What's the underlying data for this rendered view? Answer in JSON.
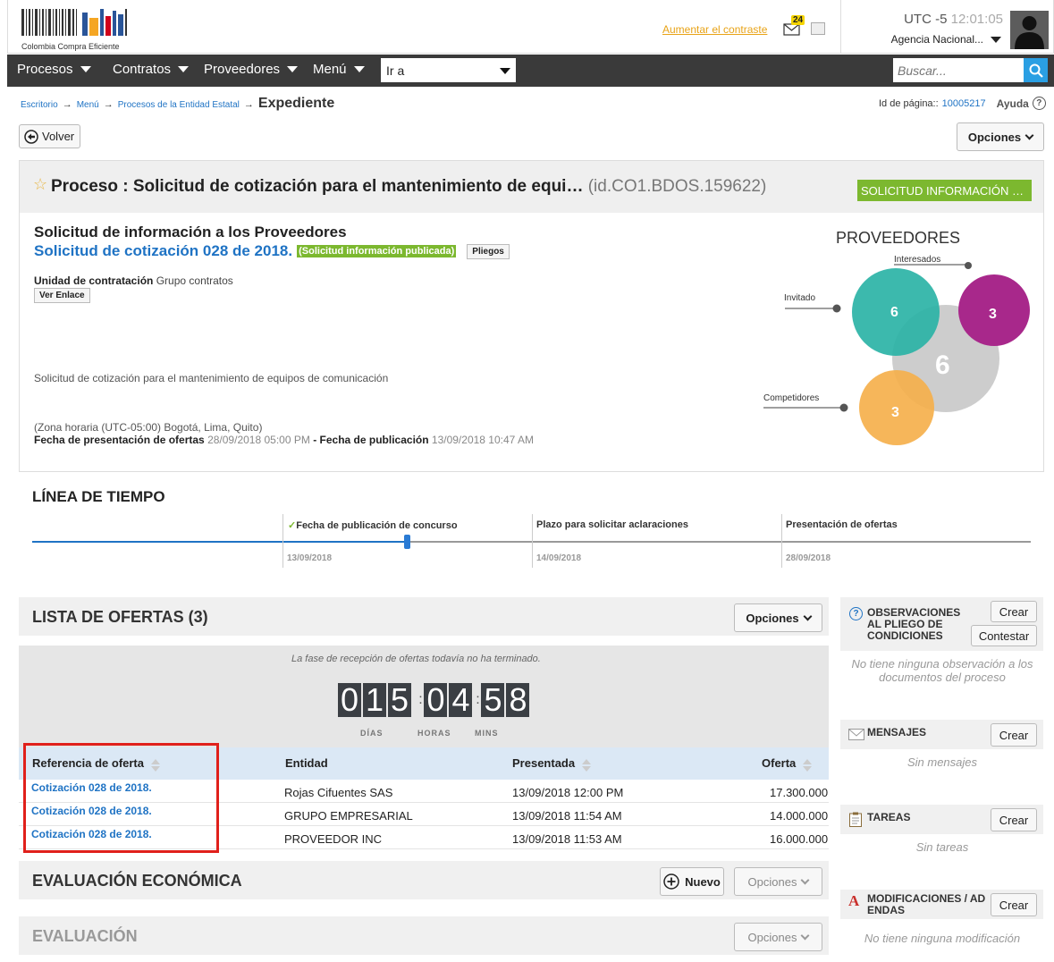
{
  "header": {
    "logo_text": "Colombia Compra Eficiente",
    "contrast_link": "Aumentar el contraste",
    "mail_count": "24",
    "timezone": "UTC -5",
    "time": "12:01:05",
    "agency": "Agencia Nacional..."
  },
  "nav": {
    "items": [
      "Procesos",
      "Contratos",
      "Proveedores",
      "Menú"
    ],
    "goto_value": "Ir a",
    "search_placeholder": "Buscar..."
  },
  "breadcrumb": {
    "items": [
      "Escritorio",
      "Menú",
      "Procesos de la Entidad Estatal"
    ],
    "current": "Expediente",
    "arrow": "→",
    "page_id_label": "Id de página::",
    "page_id": "10005217",
    "help": "Ayuda"
  },
  "toolbar": {
    "back": "Volver",
    "options": "Opciones"
  },
  "process": {
    "title": "Proceso : Solicitud de cotización para el mantenimiento de equi…",
    "id": "(id.CO1.BDOS.159622)",
    "status": "SOLICITUD INFORMACIÓN …",
    "type": "Solicitud de información a los Proveedores",
    "name": "Solicitud de cotización 028 de 2018.",
    "badge": "(Solicitud información publicada)",
    "pliegos": "Pliegos",
    "unit_label": "Unidad de contratación",
    "unit_value": "Grupo contratos",
    "link_button": "Ver Enlace",
    "description": "Solicitud de cotización para el mantenimiento de equipos de comunicación",
    "tz": "(Zona horaria (UTC-05:00) Bogotá, Lima, Quito)",
    "offers_date_label": "Fecha de presentación de ofertas",
    "offers_date": "28/09/2018 05:00 PM",
    "dash": "-",
    "pub_date_label": "Fecha de publicación",
    "pub_date": "13/09/2018 10:47 AM"
  },
  "suppliers": {
    "title": "PROVEEDORES",
    "interested_label": "Interesados",
    "invited_label": "Invitado",
    "competitors_label": "Competidores",
    "interested": "6",
    "third": "3",
    "total": "6",
    "competitors": "3",
    "colors": {
      "interested": "#2bb3a6",
      "third": "#a8288b",
      "total": "#c4c4c4",
      "competitors": "#f5b04c"
    }
  },
  "timeline": {
    "title": "LÍNEA DE TIEMPO",
    "milestones": [
      {
        "label": "Fecha de publicación de concurso",
        "date": "13/09/2018"
      },
      {
        "label": "Plazo para solicitar aclaraciones",
        "date": "14/09/2018"
      },
      {
        "label": "Presentación de ofertas",
        "date": "28/09/2018"
      }
    ]
  },
  "offers": {
    "title": "LISTA DE OFERTAS (3)",
    "options": "Opciones",
    "notice": "La fase de recepción de ofertas todavía no ha terminado.",
    "countdown": {
      "days": "015",
      "hours": "04",
      "mins": "58",
      "days_label": "DÍAS",
      "hours_label": "HORAS",
      "mins_label": "MINS"
    },
    "columns": [
      "Referencia de oferta",
      "Entidad",
      "Presentada",
      "Oferta"
    ],
    "rows": [
      {
        "ref": "Cotización 028 de 2018.",
        "entity": "Rojas Cifuentes SAS",
        "date": "13/09/2018 12:00 PM",
        "amount": "17.300.000"
      },
      {
        "ref": "Cotización 028 de 2018.",
        "entity": "GRUPO EMPRESARIAL",
        "date": "13/09/2018 11:54 AM",
        "amount": "14.000.000"
      },
      {
        "ref": "Cotización 028 de 2018.",
        "entity": "PROVEEDOR INC",
        "date": "13/09/2018 11:53 AM",
        "amount": "16.000.000"
      }
    ]
  },
  "economic": {
    "title": "EVALUACIÓN ECONÓMICA",
    "new": "Nuevo",
    "options": "Opciones"
  },
  "evaluation": {
    "title": "EVALUACIÓN",
    "options": "Opciones"
  },
  "sidebar": {
    "observations": {
      "title": "OBSERVACIONES AL PLIEGO DE CONDICIONES",
      "create": "Crear",
      "answer": "Contestar",
      "empty": "No tiene ninguna observación a los documentos del proceso"
    },
    "messages": {
      "title": "MENSAJES",
      "create": "Crear",
      "empty": "Sin mensajes"
    },
    "tasks": {
      "title": "TAREAS",
      "create": "Crear",
      "empty": "Sin tareas"
    },
    "modifications": {
      "title": "MODIFICACIONES / ADENDAS",
      "create": "Crear",
      "empty": "No tiene ninguna modificación"
    }
  },
  "colors": {
    "nav_bg": "#3a3a3a",
    "link": "#1f73c4",
    "status_green": "#7cb82f",
    "highlight_red": "#e0201b",
    "table_header": "#dbe8f5"
  }
}
